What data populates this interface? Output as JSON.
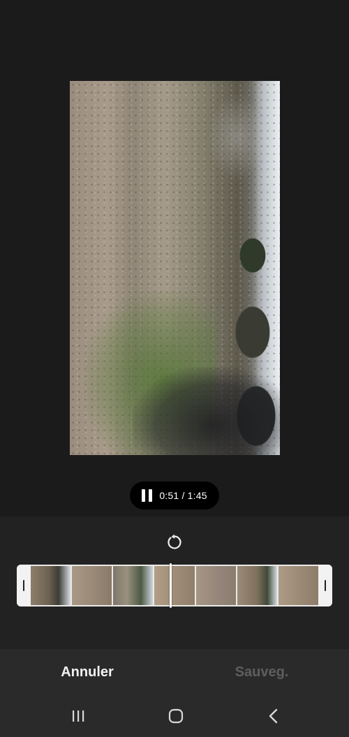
{
  "player": {
    "time_display": "0:51 / 1:45",
    "state_icon": "pause-icon"
  },
  "trim": {
    "reset_icon": "rotate-reset-icon",
    "left_handle_icon": "trim-handle-icon",
    "right_handle_icon": "trim-handle-icon",
    "thumbnail_count": 7
  },
  "actions": {
    "cancel_label": "Annuler",
    "save_label": "Sauveg."
  },
  "system_nav": {
    "recent_icon": "recent-apps-icon",
    "home_icon": "home-icon",
    "back_icon": "back-icon"
  },
  "colors": {
    "background": "#1b1b1b",
    "panel": "#222222",
    "action_bar": "#2a2a2a",
    "save_disabled": "#5e5e5e"
  }
}
